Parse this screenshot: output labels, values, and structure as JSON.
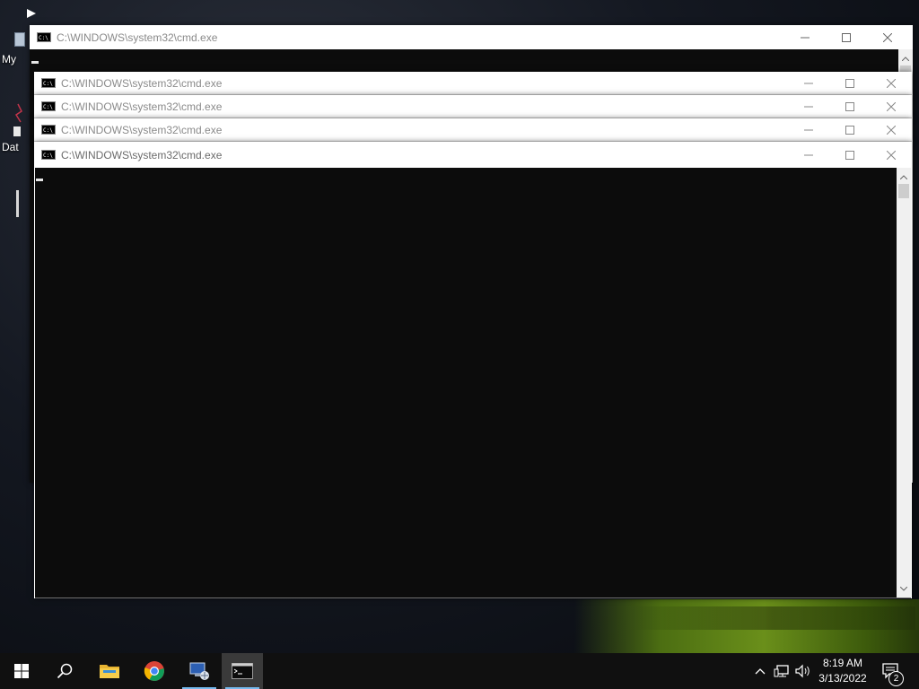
{
  "desktop": {
    "icon_labels": [
      "My",
      "Dat"
    ]
  },
  "windows": [
    {
      "title": "C:\\WINDOWS\\system32\\cmd.exe",
      "state": "background"
    },
    {
      "title": "C:\\WINDOWS\\system32\\cmd.exe",
      "state": "stacked"
    },
    {
      "title": "C:\\WINDOWS\\system32\\cmd.exe",
      "state": "stacked"
    },
    {
      "title": "C:\\WINDOWS\\system32\\cmd.exe",
      "state": "stacked"
    },
    {
      "title": "C:\\WINDOWS\\system32\\cmd.exe",
      "state": "front"
    }
  ],
  "window_controls": [
    "minimize-icon",
    "maximize-icon",
    "close-icon"
  ],
  "cmd_icon_text": "C:\\",
  "taskbar": {
    "items": [
      "start-icon",
      "search-icon",
      "file-explorer-icon",
      "chrome-icon",
      "network-computer-icon",
      "cmd-icon"
    ],
    "active_item": "cmd-icon"
  },
  "tray": {
    "icons": [
      "chevron-up-icon",
      "network-icon",
      "volume-icon"
    ],
    "time": "8:19 AM",
    "date": "3/13/2022",
    "notification_count": "2"
  },
  "colors": {
    "console_bg": "#0c0c0c",
    "taskbar_bg": "#101010",
    "accent": "#76b9ed"
  }
}
